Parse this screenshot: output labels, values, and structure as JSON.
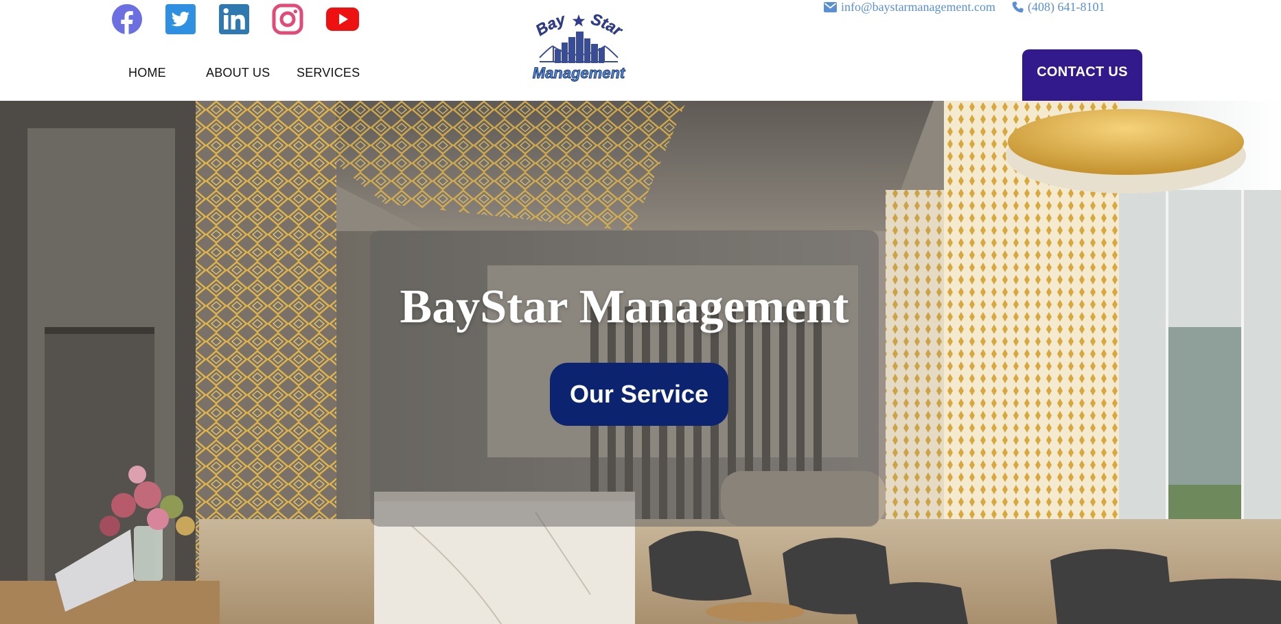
{
  "brand": {
    "logo_top": "Bay",
    "logo_top_right": "Star",
    "logo_bottom": "Management",
    "logo_alt": "Bay Star Management",
    "primary_color": "#32198c",
    "accent_color": "#5b8fd3"
  },
  "social": [
    {
      "name": "Facebook",
      "icon": "facebook-icon",
      "color": "#6c6fe0"
    },
    {
      "name": "Twitter",
      "icon": "twitter-icon",
      "color": "#2f8fe0"
    },
    {
      "name": "LinkedIn",
      "icon": "linkedin-icon",
      "color": "#2f78b0"
    },
    {
      "name": "Instagram",
      "icon": "instagram-icon",
      "color": "#e04b78"
    },
    {
      "name": "YouTube",
      "icon": "youtube-icon",
      "color": "#ee1111"
    }
  ],
  "nav": {
    "items": [
      {
        "label": "HOME"
      },
      {
        "label": "ABOUT US"
      },
      {
        "label": "SERVICES"
      }
    ]
  },
  "contact": {
    "email": "info@baystarmanagement.com",
    "email_icon": "envelope-icon",
    "phone": "(408) 641-8101",
    "phone_icon": "phone-icon",
    "button_label": "CONTACT US"
  },
  "hero": {
    "title": "BayStar Management",
    "button_label": "Our Service",
    "background": "lobby-interior-photo"
  }
}
